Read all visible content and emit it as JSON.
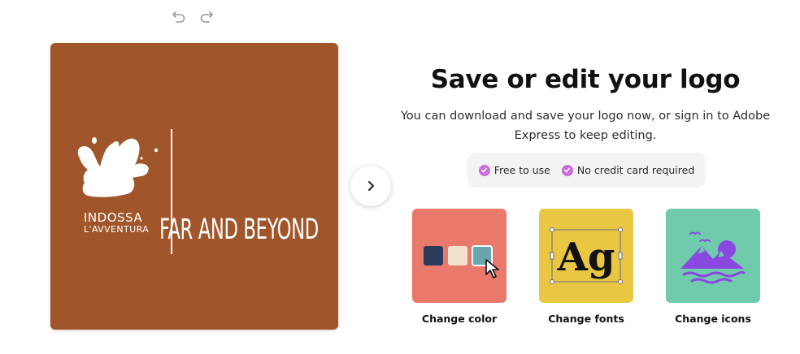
{
  "toolbar": {
    "undo_icon": "undo-icon",
    "redo_icon": "redo-icon"
  },
  "logo_preview": {
    "background": "#a0562a",
    "brand_name": "INDOSSA",
    "brand_subtitle": "L'AVVENTURA",
    "tagline": "FAR AND BEYOND",
    "icon": "splash-icon"
  },
  "nav": {
    "next_icon": "chevron-right-icon"
  },
  "panel": {
    "heading": "Save or edit your logo",
    "description": "You can download and save your logo now, or sign in to Adobe Express to keep editing.",
    "features": [
      {
        "label": "Free to use",
        "icon": "check-icon"
      },
      {
        "label": "No credit card required",
        "icon": "check-icon"
      }
    ],
    "accent": "#cb6ddc"
  },
  "options": [
    {
      "label": "Change color",
      "background": "#e8796b",
      "swatches": [
        "#2a3b5c",
        "#f3e1cf",
        "#6aa4ad"
      ],
      "icon": "color-swatches-icon"
    },
    {
      "label": "Change fonts",
      "background": "#e9c742",
      "sample_text": "Ag",
      "icon": "font-sample-icon"
    },
    {
      "label": "Change icons",
      "background": "#6fcbab",
      "icon": "mountain-icon"
    }
  ]
}
